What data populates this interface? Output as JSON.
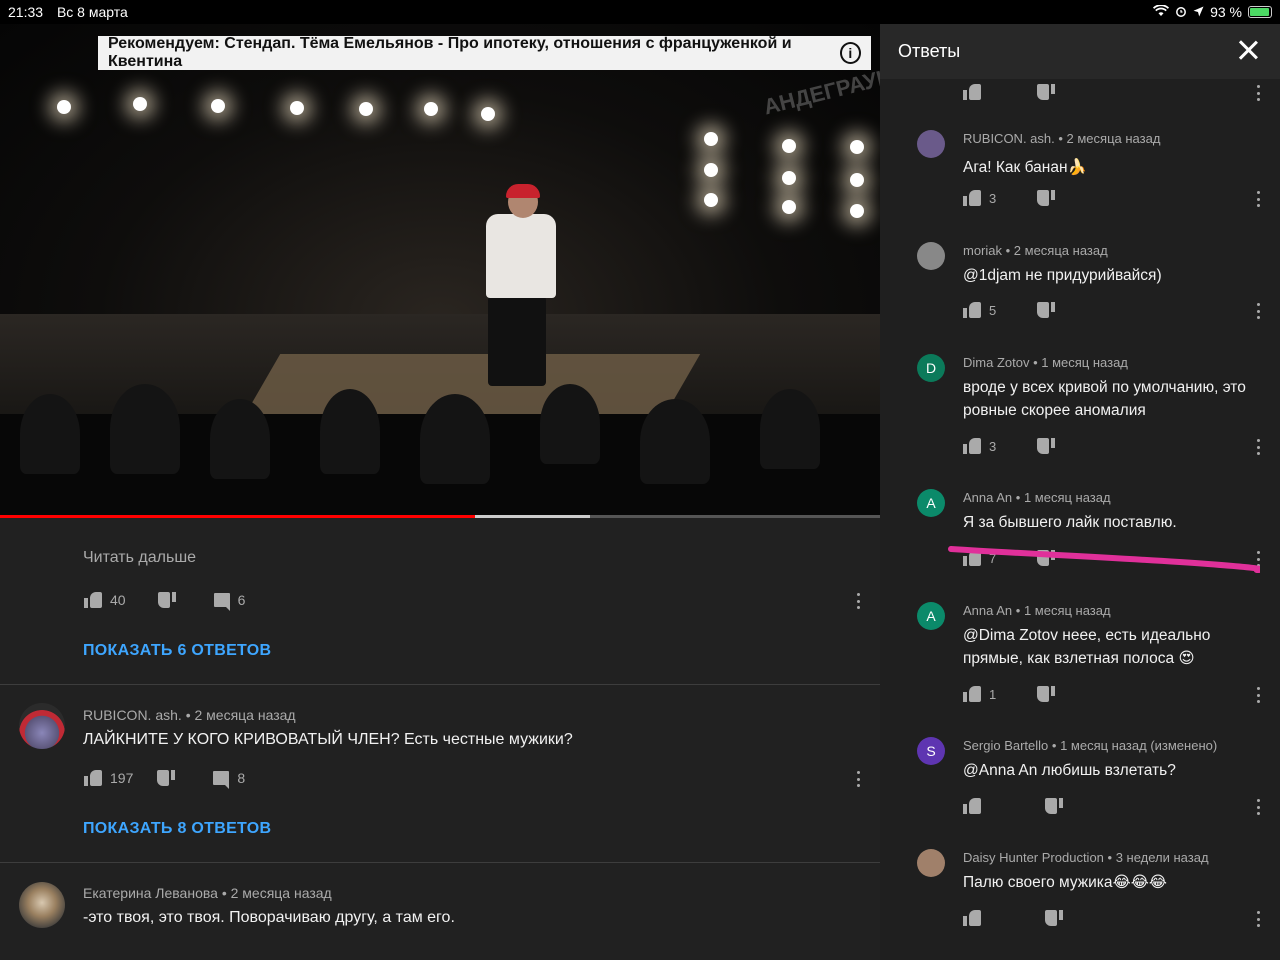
{
  "status": {
    "time": "21:33",
    "date": "Вс 8 марта",
    "battery": "93 %"
  },
  "video": {
    "recommendation": "Рекомендуем: Стендап. Тёма Емельянов - Про ипотеку, отношения с француженкой и Квентина",
    "watermark": "АНДЕГРАУНД",
    "progress_played": 0.54,
    "progress_buffered": 0.67
  },
  "left": {
    "read_more": "Читать дальше",
    "first": {
      "likes": "40",
      "replies": "6",
      "show_replies": "ПОКАЗАТЬ 6 ОТВЕТОВ"
    },
    "comments": [
      {
        "author": "RUBICON. ash.",
        "time": "2 месяца назад",
        "text": "ЛАЙКНИТЕ У КОГО КРИВОВАТЫЙ ЧЛЕН? Есть честные мужики?",
        "likes": "197",
        "replies": "8",
        "show_replies": "ПОКАЗАТЬ 8 ОТВЕТОВ"
      },
      {
        "author": "Екатерина Леванова",
        "time": "2 месяца назад",
        "text": "-это твоя, это твоя. Поворачиваю другу, а там его."
      }
    ]
  },
  "panel": {
    "title": "Ответы",
    "replies": [
      {
        "author": "RUBICON. ash.",
        "time": "2 месяца назад",
        "text": "Ага! Как банан🍌",
        "likes": "3",
        "avatar_letter": "",
        "avatar_color": "#6a5a8a"
      },
      {
        "author": "moriak",
        "time": "2 месяца назад",
        "text": "@1djam не придурийвайся)",
        "likes": "5",
        "avatar_letter": "",
        "avatar_color": "#888888"
      },
      {
        "author": "Dima Zotov",
        "time": "1 месяц назад",
        "text": "вроде у всех кривой по умолчанию, это ровные скорее аномалия",
        "likes": "3",
        "avatar_letter": "D",
        "avatar_color": "#0b7a5a"
      },
      {
        "author": "Anna An",
        "time": "1 месяц назад",
        "text": "Я за бывшего лайк поставлю.",
        "likes": "7",
        "avatar_letter": "A",
        "avatar_color": "#0b8a6a"
      },
      {
        "author": "Anna An",
        "time": "1 месяц назад",
        "text": "@Dima Zotov неее, есть идеально прямые, как взлетная полоса 😍",
        "likes": "1",
        "avatar_letter": "A",
        "avatar_color": "#0b8a6a"
      },
      {
        "author": "Sergio Bartello",
        "time": "1 месяц назад (изменено)",
        "text": "@Anna An любишь взлетать?",
        "likes": "",
        "avatar_letter": "S",
        "avatar_color": "#5e35b1"
      },
      {
        "author": "Daisy Hunter Production",
        "time": "3 недели назад",
        "text": "Палю своего мужика😂😂😂",
        "likes": "",
        "avatar_letter": "",
        "avatar_color": "#a0806a"
      }
    ],
    "top_partial": {
      "likes": ""
    }
  },
  "colors": {
    "link": "#3ea6ff",
    "highlight": "#e0309a",
    "progress": "#ff0000"
  }
}
